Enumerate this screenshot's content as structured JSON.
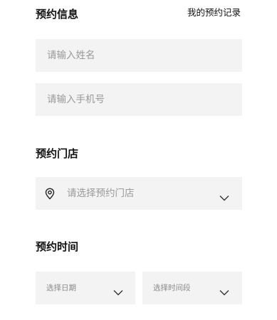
{
  "booking_info": {
    "title": "预约信息",
    "my_records_link": "我的预约记录",
    "name_placeholder": "请输入姓名",
    "phone_placeholder": "请输入手机号"
  },
  "store": {
    "title": "预约门店",
    "select_placeholder": "请选择预约门店",
    "icons": [
      "location-pin-icon",
      "chevron-down-icon"
    ]
  },
  "time": {
    "title": "预约时间",
    "date_placeholder": "选择日期",
    "slot_placeholder": "选择时间段"
  }
}
